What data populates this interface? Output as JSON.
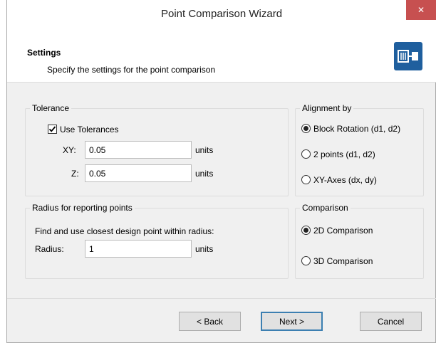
{
  "window": {
    "title": "Point Comparison Wizard",
    "close_glyph": "✕"
  },
  "header": {
    "title": "Settings",
    "subtitle": "Specify the settings for the point comparison",
    "icon": "point-comparison-icon",
    "icon_color": "#1f5f9e"
  },
  "tolerance": {
    "legend": "Tolerance",
    "use_tolerances": {
      "label": "Use Tolerances",
      "checked": true
    },
    "xy": {
      "label": "XY:",
      "value": "0.05",
      "units": "units"
    },
    "z": {
      "label": "Z:",
      "value": "0.05",
      "units": "units"
    }
  },
  "radius": {
    "legend": "Radius for reporting points",
    "description": "Find and use closest design point within radius:",
    "label": "Radius:",
    "value": "1",
    "units": "units"
  },
  "alignment": {
    "legend": "Alignment by",
    "options": [
      {
        "label": "Block Rotation (d1, d2)",
        "selected": true
      },
      {
        "label": "2 points (d1, d2)",
        "selected": false
      },
      {
        "label": "XY-Axes (dx, dy)",
        "selected": false
      }
    ]
  },
  "comparison": {
    "legend": "Comparison",
    "options": [
      {
        "label": "2D Comparison",
        "selected": true
      },
      {
        "label": "3D Comparison",
        "selected": false
      }
    ]
  },
  "buttons": {
    "back": "< Back",
    "next": "Next >",
    "cancel": "Cancel"
  }
}
